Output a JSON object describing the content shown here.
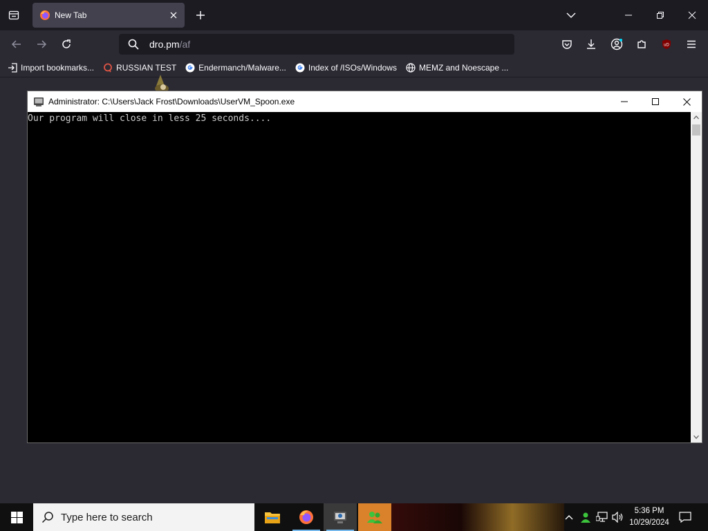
{
  "browser": {
    "tab": {
      "title": "New Tab"
    },
    "url": {
      "host": "dro.pm",
      "path": "/af"
    },
    "bookmarks": [
      {
        "label": "Import bookmarks...",
        "icon": "import-icon"
      },
      {
        "label": "RUSSIAN TEST",
        "icon": "chat-bubble-icon"
      },
      {
        "label": "Endermanch/Malware...",
        "icon": "google-icon"
      },
      {
        "label": "Index of /ISOs/Windows",
        "icon": "google-icon"
      },
      {
        "label": "MEMZ and Noescape ...",
        "icon": "globe-icon"
      }
    ],
    "extension_badge": "uD"
  },
  "console": {
    "title": "Administrator: C:\\Users\\Jack Frost\\Downloads\\UserVM_Spoon.exe",
    "output": "Our program will close in less 25 seconds...."
  },
  "taskbar": {
    "search_placeholder": "Type here to search",
    "time": "5:36 PM",
    "date": "10/29/2024"
  },
  "colors": {
    "chrome_dark": "#1c1b22",
    "chrome": "#2b2a33",
    "tab_active": "#42414d",
    "console_bg": "#000000",
    "console_text": "#cccccc",
    "taskbar": "#101010"
  }
}
